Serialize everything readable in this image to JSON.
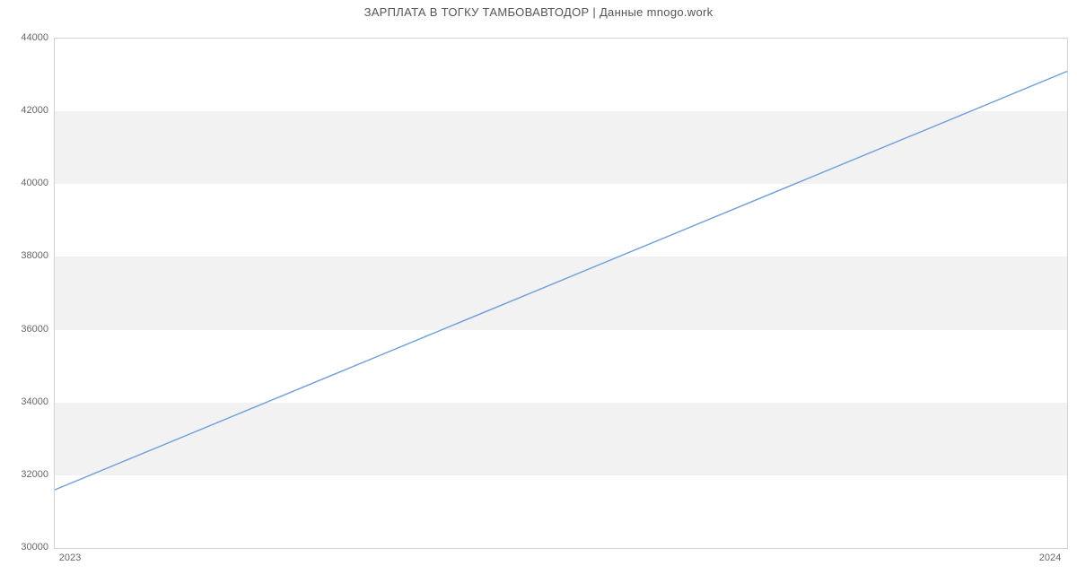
{
  "chart_data": {
    "type": "line",
    "title": "ЗАРПЛАТА В ТОГКУ ТАМБОВАВТОДОР | Данные mnogo.work",
    "xlabel": "",
    "ylabel": "",
    "x": [
      2023,
      2024
    ],
    "values": [
      31600,
      43100
    ],
    "x_ticks": [
      2023,
      2024
    ],
    "y_ticks": [
      30000,
      32000,
      34000,
      36000,
      38000,
      40000,
      42000,
      44000
    ],
    "ylim": [
      30000,
      44000
    ],
    "xlim": [
      2023,
      2024
    ],
    "grid": false,
    "line_color": "#6f9fd8"
  }
}
